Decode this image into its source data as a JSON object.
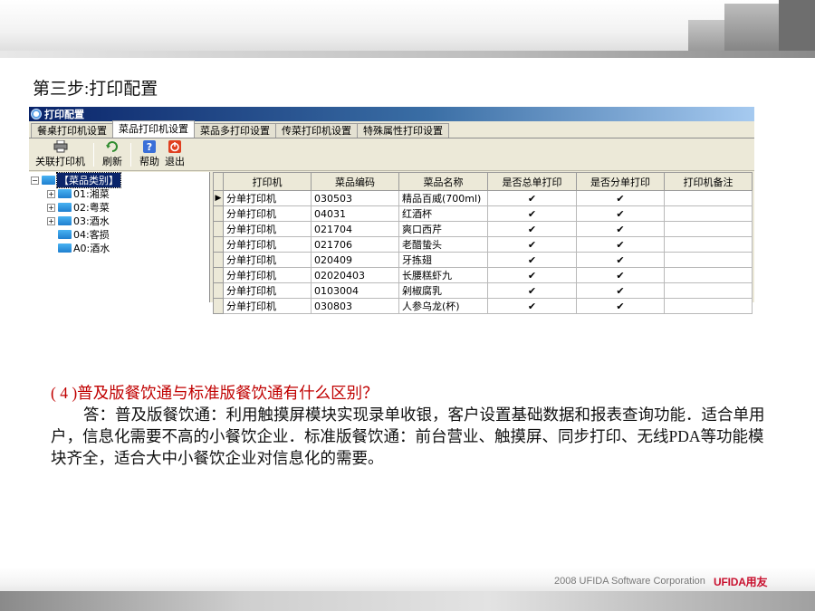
{
  "heading": "第三步:打印配置",
  "window": {
    "title": "打印配置",
    "tabs": [
      "餐桌打印机设置",
      "菜品打印机设置",
      "菜品多打印设置",
      "传菜打印机设置",
      "特殊属性打印设置"
    ],
    "active_tab": 1,
    "toolbar": [
      {
        "label": "关联打印机",
        "icon": "printer-icon"
      },
      {
        "label": "刷新",
        "icon": "refresh-icon"
      },
      {
        "label": "帮助",
        "icon": "help-icon"
      },
      {
        "label": "退出",
        "icon": "exit-icon"
      }
    ],
    "tree": {
      "root": "【菜品类别】",
      "items": [
        "01:湘菜",
        "02:粤菜",
        "03:酒水",
        "04:客损",
        "A0:酒水"
      ]
    },
    "grid": {
      "columns": [
        "打印机",
        "菜品编码",
        "菜品名称",
        "是否总单打印",
        "是否分单打印",
        "打印机备注"
      ],
      "rows": [
        {
          "printer": "分单打印机",
          "code": "030503",
          "name": "精品百威(700ml)",
          "total": "✔",
          "split": "✔",
          "note": ""
        },
        {
          "printer": "分单打印机",
          "code": "04031",
          "name": "红酒杯",
          "total": "✔",
          "split": "✔",
          "note": ""
        },
        {
          "printer": "分单打印机",
          "code": "021704",
          "name": "爽口西芹",
          "total": "✔",
          "split": "✔",
          "note": ""
        },
        {
          "printer": "分单打印机",
          "code": "021706",
          "name": "老醋蛰头",
          "total": "✔",
          "split": "✔",
          "note": ""
        },
        {
          "printer": "分单打印机",
          "code": "020409",
          "name": "牙拣翅",
          "total": "✔",
          "split": "✔",
          "note": ""
        },
        {
          "printer": "分单打印机",
          "code": "02020403",
          "name": "长腰糕虾九",
          "total": "✔",
          "split": "✔",
          "note": ""
        },
        {
          "printer": "分单打印机",
          "code": "0103004",
          "name": "剁椒腐乳",
          "total": "✔",
          "split": "✔",
          "note": ""
        },
        {
          "printer": "分单打印机",
          "code": "030803",
          "name": "人参乌龙(杯)",
          "total": "✔",
          "split": "✔",
          "note": ""
        }
      ]
    }
  },
  "question": "( 4 )普及版餐饮通与标准版餐饮通有什么区别？",
  "answer": "答：普及版餐饮通：利用触摸屏模块实现录单收银，客户设置基础数据和报表查询功能．适合单用户，信息化需要不高的小餐饮企业．标准版餐饮通：前台营业、触摸屏、同步打印、无线PDA等功能模块齐全，适合大中小餐饮企业对信息化的需要。",
  "footer": {
    "copyright": "2008 UFIDA Software Corporation",
    "brand": "UFIDA用友"
  },
  "colors": {
    "question": "#c00000",
    "titlebar": "#0a246a",
    "brand": "#c8102e"
  }
}
